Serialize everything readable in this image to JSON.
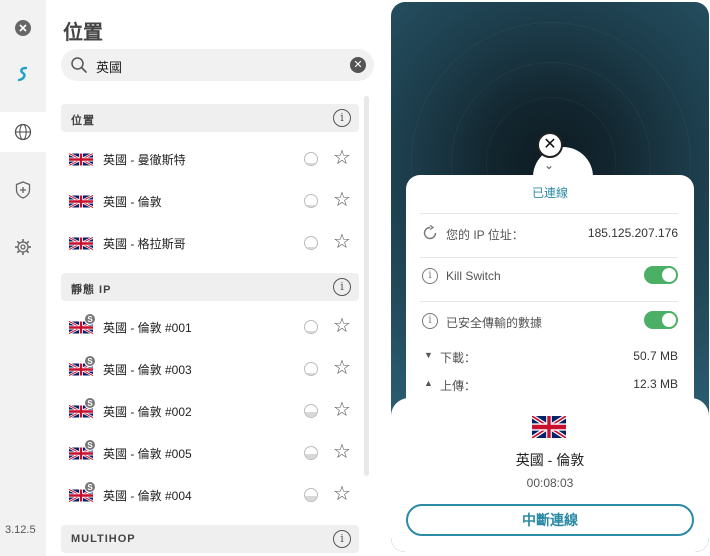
{
  "app": {
    "version": "3.12.5"
  },
  "sidebar": {
    "items": [
      {
        "icon": "close-icon"
      },
      {
        "icon": "surfshark-logo-icon"
      },
      {
        "icon": "globe-icon"
      },
      {
        "icon": "shield-icon"
      },
      {
        "icon": "gear-icon"
      }
    ]
  },
  "locations": {
    "title": "位置",
    "search": {
      "value": "英國",
      "icon": "search-icon"
    },
    "sections": [
      {
        "label": "位置",
        "rows": [
          {
            "label": "英國 - 曼徹斯特",
            "load": 0.15
          },
          {
            "label": "英國 - 倫敦",
            "load": 0.15
          },
          {
            "label": "英國 - 格拉斯哥",
            "load": 0.15
          }
        ]
      },
      {
        "label": "靜態 IP",
        "rows": [
          {
            "label": "英國 - 倫敦 #001",
            "load": 0.15,
            "badge": "S"
          },
          {
            "label": "英國 - 倫敦 #003",
            "load": 0.15,
            "badge": "S"
          },
          {
            "label": "英國 - 倫敦 #002",
            "load": 0.4,
            "badge": "S"
          },
          {
            "label": "英國 - 倫敦 #005",
            "load": 0.4,
            "badge": "S"
          },
          {
            "label": "英國 - 倫敦 #004",
            "load": 0.4,
            "badge": "S"
          }
        ]
      },
      {
        "label": "MULTIHOP",
        "rows": []
      }
    ]
  },
  "connection": {
    "status": "已連線",
    "ip_label": "您的 IP 位址：",
    "ip_value": "185.125.207.176",
    "kill_switch_label": "Kill Switch",
    "kill_switch_on": true,
    "secure_data_label": "已安全傳輸的數據",
    "secure_data_on": true,
    "download_label": "下載：",
    "download_value": "50.7 MB",
    "upload_label": "上傳：",
    "upload_value": "12.3 MB",
    "location": "英國 - 倫敦",
    "duration": "00:08:03",
    "disconnect_label": "中斷連線"
  },
  "colors": {
    "accent": "#2b8aa6",
    "toggle_on": "#4caf66",
    "map_bg": "#1f4352"
  }
}
